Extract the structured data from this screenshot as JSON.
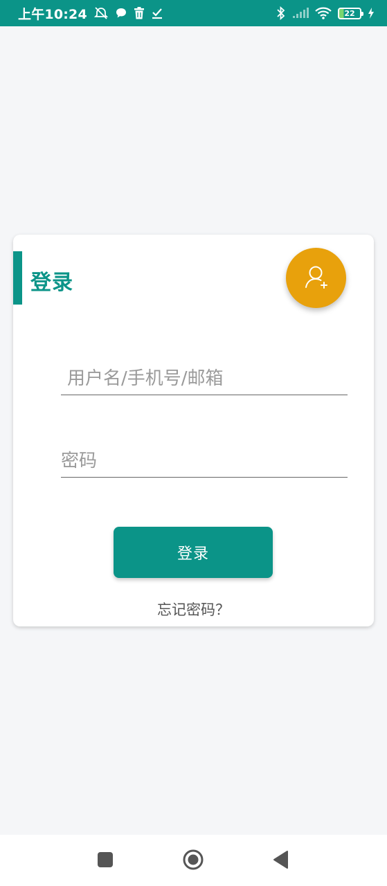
{
  "status_bar": {
    "time": "上午10:24",
    "battery_level": "22",
    "background_color": "#0b9488",
    "left_icons": [
      "alarm-off-icon",
      "chat-bubble-icon",
      "trash-icon",
      "check-download-icon"
    ],
    "right_icons": [
      "bluetooth-icon",
      "signal-icon",
      "wifi-icon",
      "battery-icon",
      "charging-bolt-icon"
    ]
  },
  "login_card": {
    "title": "登录",
    "fab_icon": "user-add-icon",
    "username_placeholder": "用户名/手机号/邮箱",
    "username_value": "",
    "password_placeholder": "密码",
    "password_value": "",
    "login_button_label": "登录",
    "forgot_password_label": "忘记密码？"
  },
  "nav_bar": {
    "icons": [
      "recent-apps-icon",
      "home-icon",
      "back-icon"
    ]
  },
  "colors": {
    "primary": "#0b9488",
    "accent": "#e8a10c",
    "page_background": "#f5f6f8",
    "card_background": "#ffffff"
  }
}
